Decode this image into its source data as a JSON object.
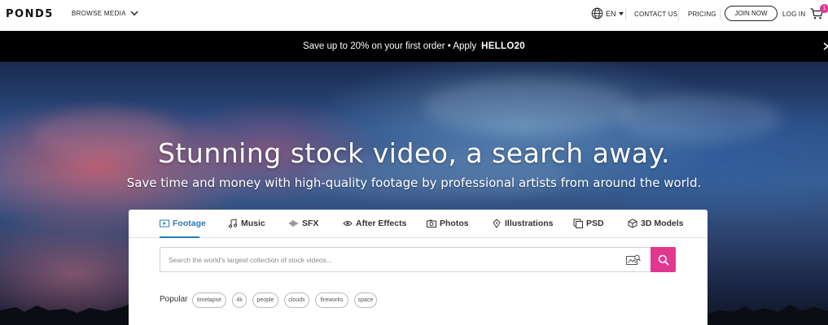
{
  "header": {
    "logo": "POND5",
    "browse_label": "BROWSE MEDIA",
    "lang": "EN",
    "contact": "CONTACT US",
    "pricing": "PRICING",
    "join": "JOIN NOW",
    "login": "LOG IN",
    "cart_count": "1"
  },
  "promo": {
    "text": "Save up to 20% on your first order • Apply",
    "code": "HELLO20"
  },
  "hero": {
    "headline": "Stunning stock video, a search away.",
    "subhead": "Save time and money with high-quality footage by professional artists from around the world."
  },
  "tabs": [
    {
      "label": "Footage",
      "icon": "film-icon",
      "active": true
    },
    {
      "label": "Music",
      "icon": "music-note-icon"
    },
    {
      "label": "SFX",
      "icon": "sound-wave-icon"
    },
    {
      "label": "After Effects",
      "icon": "after-effects-icon"
    },
    {
      "label": "Photos",
      "icon": "camera-icon"
    },
    {
      "label": "Illustrations",
      "icon": "pen-nib-icon"
    },
    {
      "label": "PSD",
      "icon": "psd-icon"
    },
    {
      "label": "3D Models",
      "icon": "cube-icon"
    }
  ],
  "search": {
    "placeholder": "Search the world's largest collection of stock videos...",
    "value": ""
  },
  "popular": {
    "label": "Popular",
    "tags": [
      "timelapse",
      "4k",
      "people",
      "clouds",
      "fireworks",
      "space"
    ]
  },
  "colors": {
    "accent": "#e2378f",
    "active_tab": "#2a7ab5",
    "promo_bg": "#000000"
  }
}
